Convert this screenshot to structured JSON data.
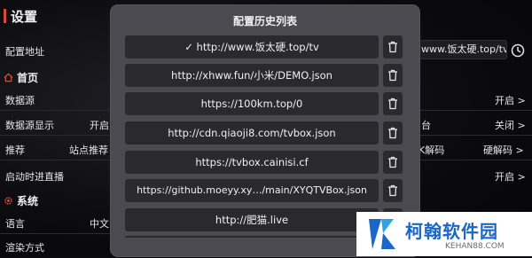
{
  "page": {
    "title": "设置"
  },
  "settings": {
    "config_address_label": "配置地址",
    "config_address_value": "www.饭太硬.top/tv",
    "home_section": "首页",
    "datasource_label": "数据源",
    "datasource_value": "开启 >",
    "datasource_display_label": "数据源显示",
    "datasource_display_value": "开启",
    "right_col_label_1": "台",
    "right_col_value_1": "关闭 >",
    "recommend_label": "推荐",
    "recommend_value": "站点推荐",
    "right_col_label_2": "K解码",
    "right_col_value_2": "硬解码 >",
    "startup_live_label": "启动时进直播",
    "startup_live_value": "开启 >",
    "system_section": "系统",
    "language_label": "语言",
    "language_value": "中文",
    "render_label": "渲染方式"
  },
  "modal": {
    "title": "配置历史列表",
    "items": [
      "✓ http://www.饭太硬.top/tv",
      "http://xhww.fun/小米/DEMO.json",
      "https://100km.top/0",
      "http://cdn.qiaoji8.com/tvbox.json",
      "https://tvbox.cainisi.cf",
      "https://github.moeyy.xy…/main/XYQTVBox.json",
      "http://肥猫.live"
    ]
  },
  "watermark": {
    "name": "柯翰软件园",
    "url": "KEHAN88.COM"
  },
  "colors": {
    "accent": "#d94a3a",
    "modal_bg": "#4a4a50",
    "item_bg": "#2a2a2e",
    "brand": "#1b66c9"
  },
  "icons": {
    "home": "home-icon",
    "system": "gear-icon",
    "history": "clock-icon",
    "delete": "trash-icon"
  }
}
